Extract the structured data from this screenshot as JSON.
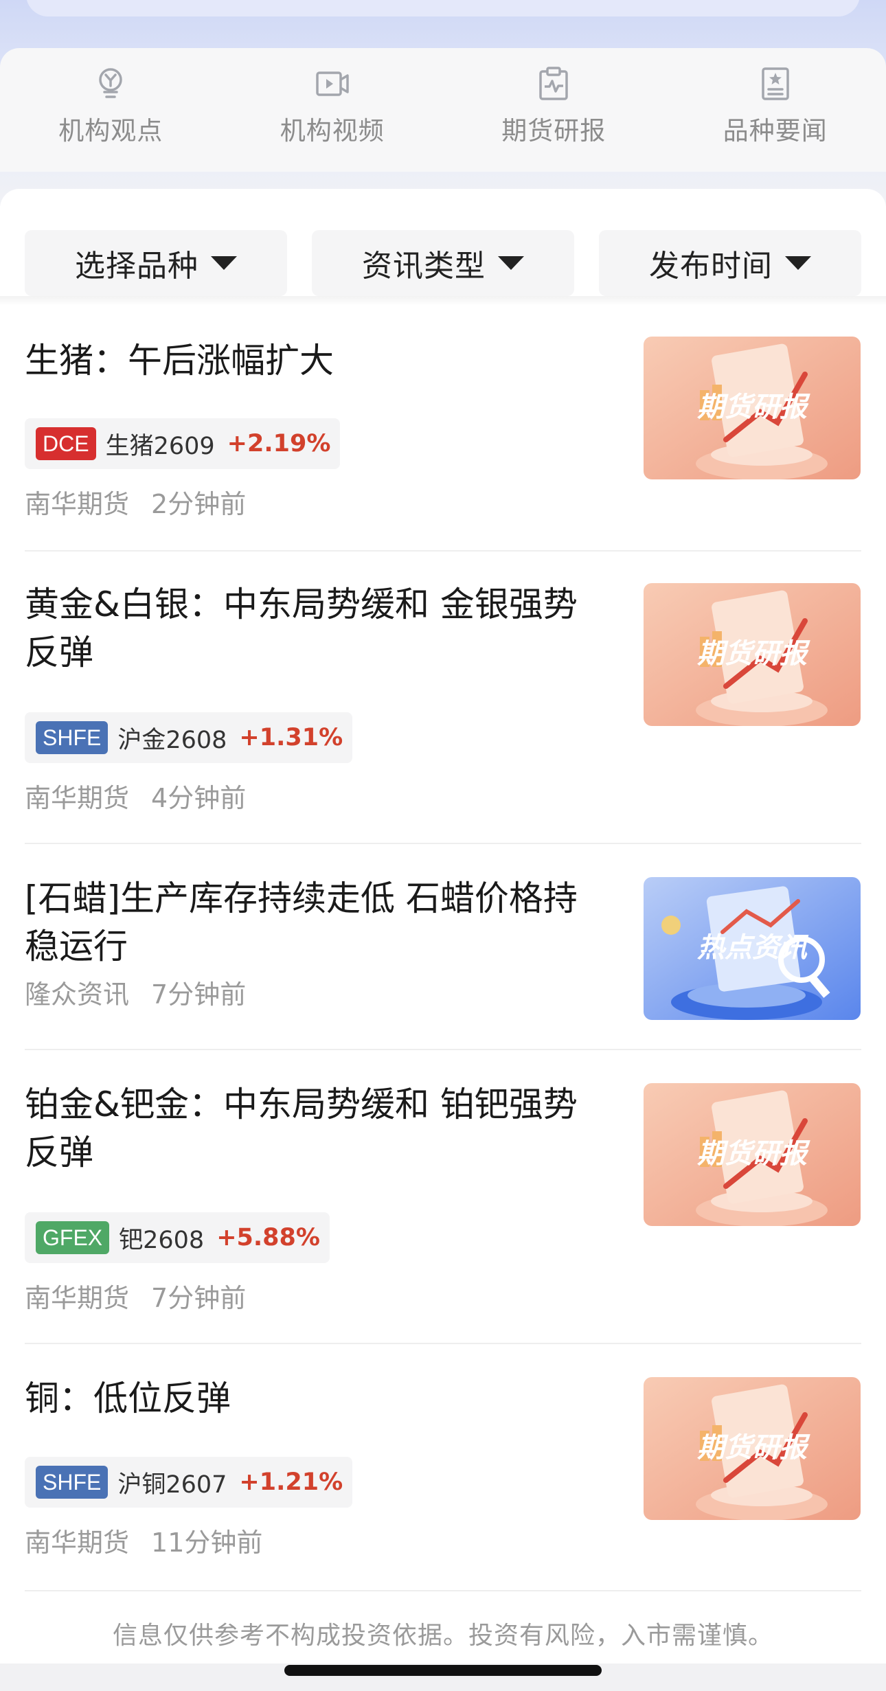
{
  "quick_nav": [
    {
      "label": "机构观点",
      "icon": "bulb-y-icon"
    },
    {
      "label": "机构视频",
      "icon": "video-play-icon"
    },
    {
      "label": "期货研报",
      "icon": "clipboard-pulse-icon"
    },
    {
      "label": "品种要闻",
      "icon": "star-document-icon"
    }
  ],
  "filters": {
    "variety": "选择品种",
    "info_type": "资讯类型",
    "publish_time": "发布时间"
  },
  "news": [
    {
      "title": "生猪：午后涨幅扩大",
      "tag": {
        "exchange": "DCE",
        "exchange_color": "#d72f2f",
        "contract": "生猪2609",
        "change": "+2.19%"
      },
      "source": "南华期货",
      "time": "2分钟前",
      "thumb_label": "期货研报",
      "thumb_style": "futures"
    },
    {
      "title": "黄金&白银：中东局势缓和 金银强势反弹",
      "tag": {
        "exchange": "SHFE",
        "exchange_color": "#4a72b5",
        "contract": "沪金2608",
        "change": "+1.31%"
      },
      "source": "南华期货",
      "time": "4分钟前",
      "thumb_label": "期货研报",
      "thumb_style": "futures"
    },
    {
      "title": "[石蜡]生产库存持续走低 石蜡价格持稳运行",
      "tag": null,
      "source": "隆众资讯",
      "time": "7分钟前",
      "thumb_label": "热点资讯",
      "thumb_style": "hot"
    },
    {
      "title": "铂金&钯金：中东局势缓和 铂钯强势反弹",
      "tag": {
        "exchange": "GFEX",
        "exchange_color": "#4fa866",
        "contract": "钯2608",
        "change": "+5.88%"
      },
      "source": "南华期货",
      "time": "7分钟前",
      "thumb_label": "期货研报",
      "thumb_style": "futures"
    },
    {
      "title": "铜：低位反弹",
      "tag": {
        "exchange": "SHFE",
        "exchange_color": "#4a72b5",
        "contract": "沪铜2607",
        "change": "+1.21%"
      },
      "source": "南华期货",
      "time": "11分钟前",
      "thumb_label": "期货研报",
      "thumb_style": "futures"
    }
  ],
  "disclaimer": "信息仅供参考不构成投资依据。投资有风险，入市需谨慎。",
  "colors": {
    "accent_up": "#d2412c",
    "muted_text": "#9a9a9a"
  }
}
